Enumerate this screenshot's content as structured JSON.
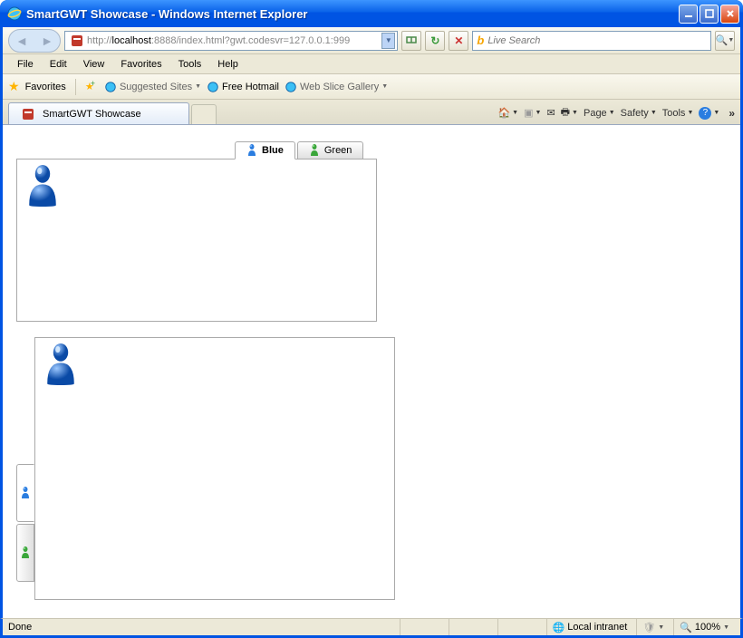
{
  "window": {
    "title": "SmartGWT Showcase - Windows Internet Explorer"
  },
  "address": {
    "prefix": "http://",
    "host": "localhost",
    "port_path": ":8888/index.html?gwt.codesvr=127.0.0.1:999"
  },
  "search": {
    "placeholder": "Live Search"
  },
  "menus": {
    "file": "File",
    "edit": "Edit",
    "view": "View",
    "favorites": "Favorites",
    "tools": "Tools",
    "help": "Help"
  },
  "favbar": {
    "label": "Favorites",
    "suggested": "Suggested Sites",
    "hotmail": "Free Hotmail",
    "slices": "Web Slice Gallery"
  },
  "tabs": {
    "current": "SmartGWT Showcase"
  },
  "cmdbar": {
    "page": "Page",
    "safety": "Safety",
    "tools": "Tools"
  },
  "app": {
    "tab_blue": "Blue",
    "tab_green": "Green"
  },
  "status": {
    "left": "Done",
    "zone": "Local intranet",
    "zoom": "100%"
  },
  "colors": {
    "chrome_blue": "#0054e3",
    "pawn_blue": "#2a7de0",
    "pawn_green": "#3aa63a"
  }
}
